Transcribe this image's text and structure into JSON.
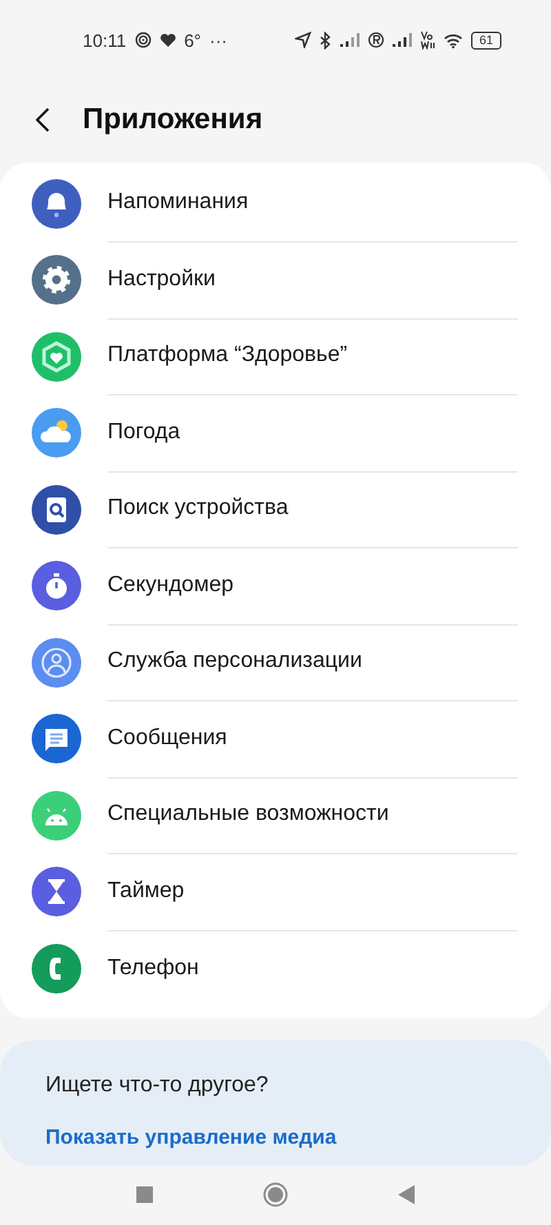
{
  "status_bar": {
    "time": "10:11",
    "temperature": "6°",
    "more": "···",
    "battery": "61"
  },
  "header": {
    "title": "Приложения"
  },
  "apps": [
    {
      "name": "Напоминания",
      "kind": "bell",
      "color": "#3f5fbf"
    },
    {
      "name": "Настройки",
      "kind": "gear",
      "color": "#54708a"
    },
    {
      "name": "Платформа “Здоровье”",
      "kind": "health",
      "color": "#1fbf6a"
    },
    {
      "name": "Погода",
      "kind": "weather",
      "color": "#4a9cf0"
    },
    {
      "name": "Поиск устройства",
      "kind": "finder",
      "color": "#2f4fa8"
    },
    {
      "name": "Секундомер",
      "kind": "stopwatch",
      "color": "#5a5ee0"
    },
    {
      "name": "Служба персонализации",
      "kind": "person",
      "color": "#5b8ef0"
    },
    {
      "name": "Сообщения",
      "kind": "messages",
      "color": "#1a66d2"
    },
    {
      "name": "Специальные возможности",
      "kind": "android",
      "color": "#3ccf7a"
    },
    {
      "name": "Таймер",
      "kind": "hourglass",
      "color": "#5a5ee0"
    },
    {
      "name": "Телефон",
      "kind": "phone",
      "color": "#139c5a"
    }
  ],
  "suggestion": {
    "question": "Ищете что-то другое?",
    "link": "Показать управление медиа"
  }
}
